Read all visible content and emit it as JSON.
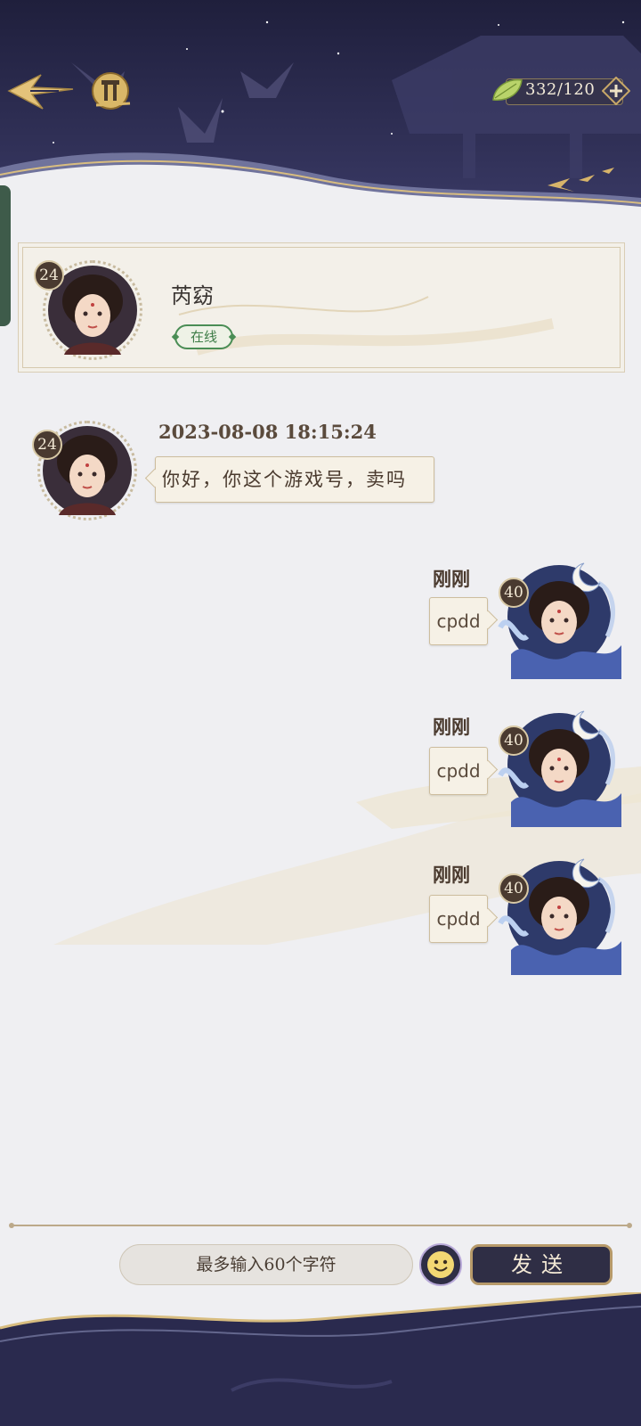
{
  "header": {
    "stamina": "332/120",
    "back_icon": "back-arrow-icon",
    "home_icon": "gate-home-icon",
    "plus_icon": "plus-icon",
    "leaf_icon": "leaf-icon"
  },
  "contact": {
    "name": "芮窈",
    "level": "24",
    "status": "在线"
  },
  "messages": [
    {
      "direction": "incoming",
      "time": "2023-08-08  18:15:24",
      "level": "24",
      "text": "你好，你这个游戏号，卖吗"
    },
    {
      "direction": "outgoing",
      "time": "刚刚",
      "level": "40",
      "text": "cpdd"
    },
    {
      "direction": "outgoing",
      "time": "刚刚",
      "level": "40",
      "text": "cpdd"
    },
    {
      "direction": "outgoing",
      "time": "刚刚",
      "level": "40",
      "text": "cpdd"
    }
  ],
  "input": {
    "placeholder": "最多输入60个字符",
    "send_label": "发送",
    "emoji_icon": "smiley-face-icon"
  },
  "colors": {
    "header_navy": "#2a2a4e",
    "gold": "#c9a664",
    "online_green": "#4a8d55",
    "background": "#efeff2"
  }
}
